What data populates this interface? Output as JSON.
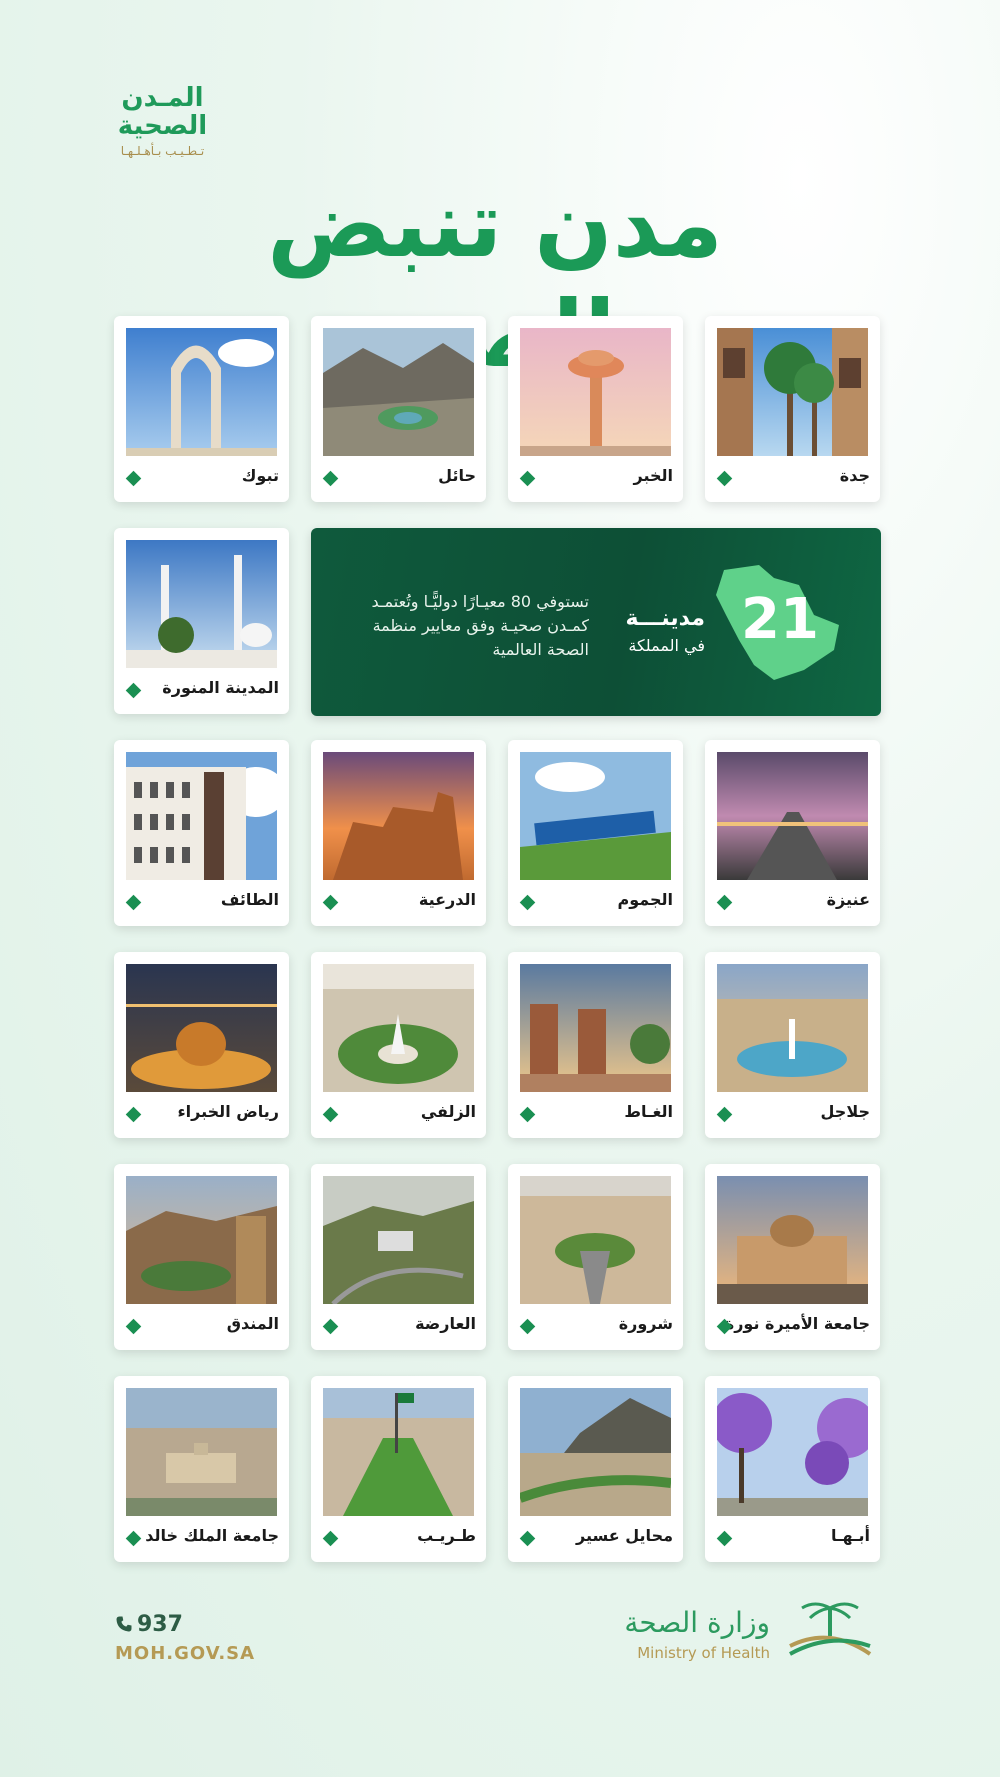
{
  "logo": {
    "line1": "المـدن",
    "line2": "الصحية",
    "tagline": "تـطـيـب بـأهـلـهـا"
  },
  "title": "مدن تنبض بالصحة",
  "colors": {
    "brand_green": "#1b9a57",
    "dark_green": "#0f5a3c",
    "gold": "#b59a54"
  },
  "cities": [
    {
      "name": "جدة"
    },
    {
      "name": "الخبر"
    },
    {
      "name": "حائل"
    },
    {
      "name": "تبوك"
    },
    {
      "name": "المدينة المنورة"
    },
    {
      "name": "عنيزة"
    },
    {
      "name": "الجموم"
    },
    {
      "name": "الدرعية"
    },
    {
      "name": "الطائف"
    },
    {
      "name": "جلاجل"
    },
    {
      "name": "الغـاط"
    },
    {
      "name": "الزلفي"
    },
    {
      "name": "رياض الخبراء"
    },
    {
      "name": "جامعة الأميرة نورة"
    },
    {
      "name": "شرورة"
    },
    {
      "name": "العارضة"
    },
    {
      "name": "المندق"
    },
    {
      "name": "أبـهـا"
    },
    {
      "name": "محايل عسير"
    },
    {
      "name": "طـريـب"
    },
    {
      "name": "جامعة الملك خالد"
    }
  ],
  "banner": {
    "count": "21",
    "count_label": "مدينـــة",
    "scope": "في المملكة",
    "desc": "تستوفي 80 معيـارًا دوليًّـا وتُعتمـد كمـدن صحيـة وفق معايير منظمة الصحة العالمية"
  },
  "footer": {
    "phone": "937",
    "website": "MOH.GOV.SA",
    "ministry_ar": "وزارة الصحة",
    "ministry_en": "Ministry of Health"
  }
}
